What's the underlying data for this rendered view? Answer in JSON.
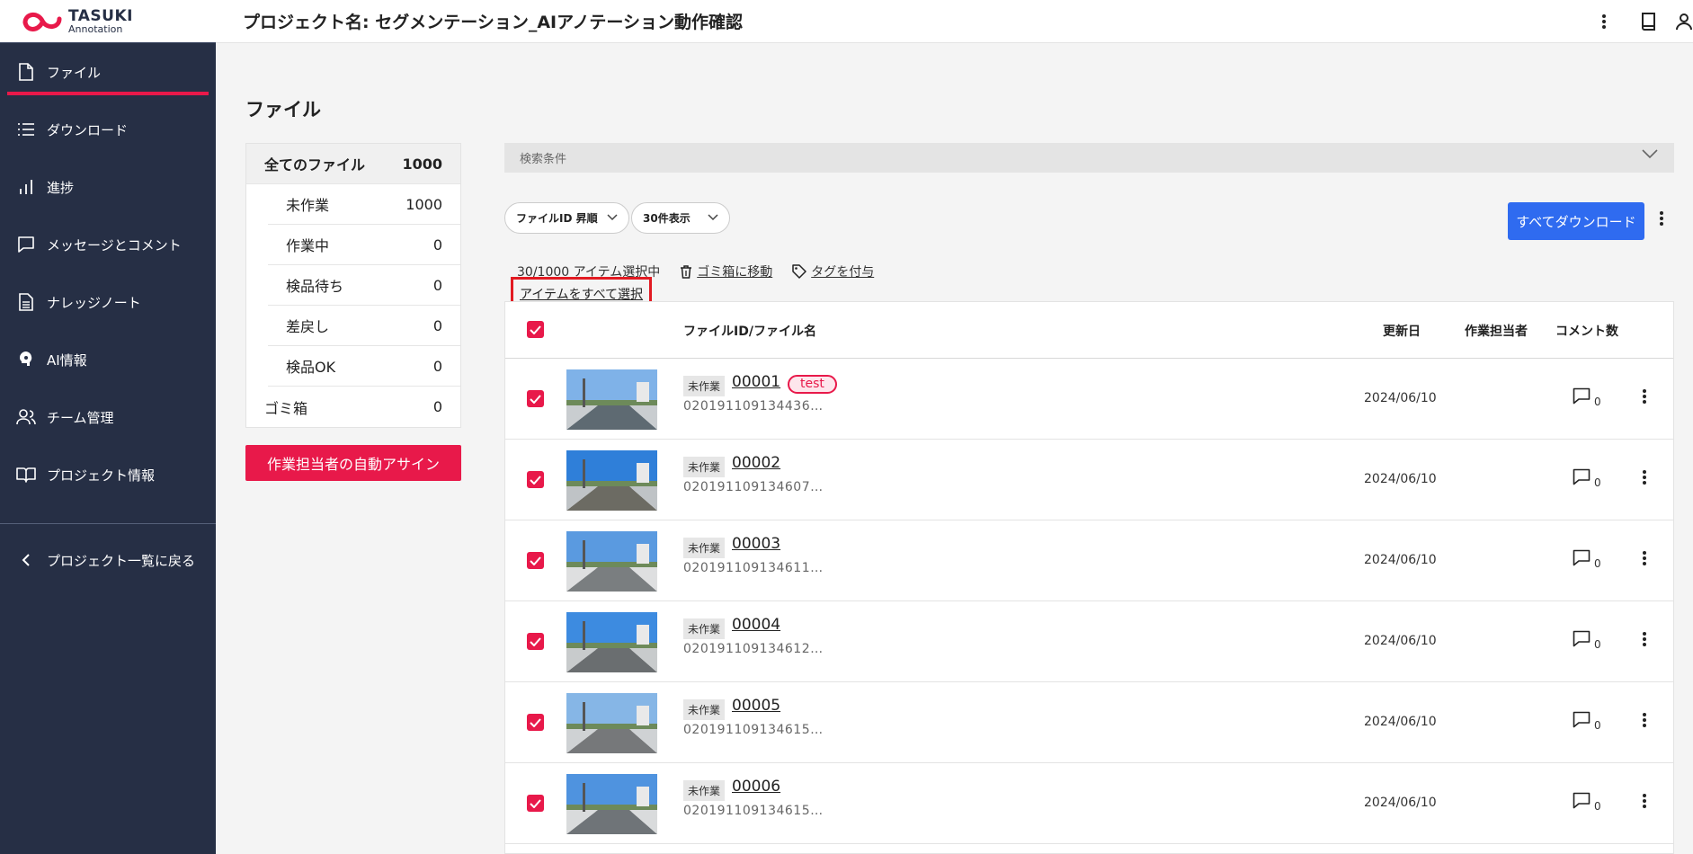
{
  "app": {
    "logo_line1": "TASUKI",
    "logo_line2": "Annotation",
    "brand_color": "#e8194a"
  },
  "sidebar": {
    "items": [
      {
        "label": "ファイル",
        "icon": "file-icon"
      },
      {
        "label": "ダウンロード",
        "icon": "list-icon"
      },
      {
        "label": "進捗",
        "icon": "bar-chart-icon"
      },
      {
        "label": "メッセージとコメント",
        "icon": "chat-icon"
      },
      {
        "label": "ナレッジノート",
        "icon": "document-icon"
      },
      {
        "label": "AI情報",
        "icon": "ai-brain-icon"
      },
      {
        "label": "チーム管理",
        "icon": "team-icon"
      },
      {
        "label": "プロジェクト情報",
        "icon": "book-icon"
      }
    ],
    "back_label": "プロジェクト一覧に戻る"
  },
  "header": {
    "title": "プロジェクト名: セグメンテーション_AIアノテーション動作確認"
  },
  "main": {
    "heading": "ファイル",
    "filters": [
      {
        "label": "全てのファイル",
        "count": "1000"
      },
      {
        "label": "未作業",
        "count": "1000"
      },
      {
        "label": "作業中",
        "count": "0"
      },
      {
        "label": "検品待ち",
        "count": "0"
      },
      {
        "label": "差戻し",
        "count": "0"
      },
      {
        "label": "検品OK",
        "count": "0"
      },
      {
        "label": "ゴミ箱",
        "count": "0"
      }
    ],
    "assign_button": "作業担当者の自動アサイン",
    "search_label": "検索条件",
    "sort_select": "ファイルID 昇順",
    "page_size_select": "30件表示",
    "download_all": "すべてダウンロード",
    "selection_text": "30/1000 アイテム選択中",
    "move_to_trash": "ゴミ箱に移動",
    "add_tag": "タグを付与",
    "select_all": "アイテムをすべて選択"
  },
  "table": {
    "headers": {
      "file": "ファイルID/ファイル名",
      "updated": "更新日",
      "assignee": "作業担当者",
      "comments": "コメント数"
    },
    "rows": [
      {
        "status": "未作業",
        "id": "00001",
        "tag": "test",
        "name": "020191109134436…",
        "date": "2024/06/10",
        "comments": "0"
      },
      {
        "status": "未作業",
        "id": "00002",
        "tag": "",
        "name": "020191109134607…",
        "date": "2024/06/10",
        "comments": "0"
      },
      {
        "status": "未作業",
        "id": "00003",
        "tag": "",
        "name": "020191109134611…",
        "date": "2024/06/10",
        "comments": "0"
      },
      {
        "status": "未作業",
        "id": "00004",
        "tag": "",
        "name": "020191109134612…",
        "date": "2024/06/10",
        "comments": "0"
      },
      {
        "status": "未作業",
        "id": "00005",
        "tag": "",
        "name": "020191109134615…",
        "date": "2024/06/10",
        "comments": "0"
      },
      {
        "status": "未作業",
        "id": "00006",
        "tag": "",
        "name": "020191109134615…",
        "date": "2024/06/10",
        "comments": "0"
      }
    ]
  }
}
